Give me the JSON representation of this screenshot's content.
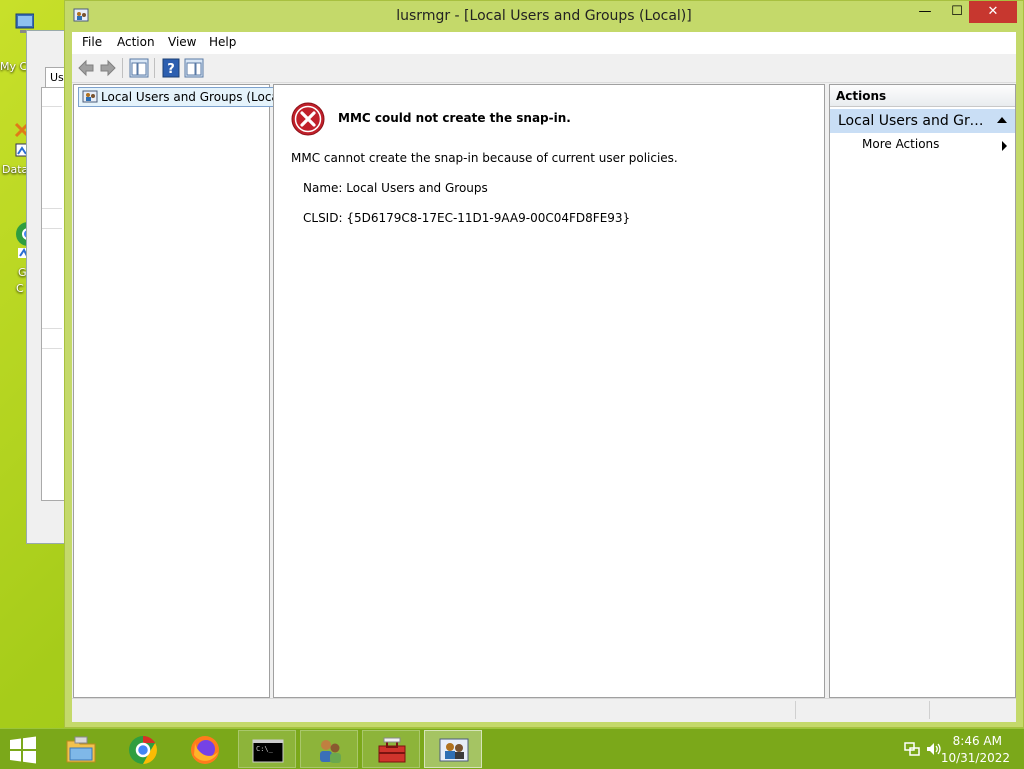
{
  "desktop": {
    "icons": [
      {
        "label": "My C"
      },
      {
        "label": "Data"
      },
      {
        "label": "G"
      },
      {
        "label": "C"
      }
    ],
    "background_window": {
      "tab_label": "Use"
    }
  },
  "window": {
    "title": "lusrmgr - [Local Users and Groups (Local)]",
    "buttons": {
      "minimize": "—",
      "maximize": "☐",
      "close": "✕"
    }
  },
  "menu": [
    "File",
    "Action",
    "View",
    "Help"
  ],
  "tree": {
    "root_label": "Local Users and Groups (Local)"
  },
  "content": {
    "error_title": "MMC could not create the snap-in.",
    "error_message": "MMC cannot create the snap-in because of current user policies.",
    "name_line": "Name: Local Users and Groups",
    "clsid_line": "CLSID: {5D6179C8-17EC-11D1-9AA9-00C04FD8FE93}"
  },
  "actions": {
    "header": "Actions",
    "group_label": "Local Users and Groups (Local)",
    "more_actions": "More Actions"
  },
  "taskbar": {
    "time": "8:46 AM",
    "date": "10/31/2022",
    "apps": [
      "file-explorer",
      "chrome",
      "firefox",
      "command-prompt",
      "user-accounts",
      "toolbox",
      "lusrmgr"
    ]
  },
  "colors": {
    "desktop": "#a6cc1a",
    "window_frame": "#c4d96a",
    "taskbar": "#7ba81a",
    "close_button": "#c7372f",
    "selection": "#c9def5",
    "error_red": "#c0202a"
  }
}
